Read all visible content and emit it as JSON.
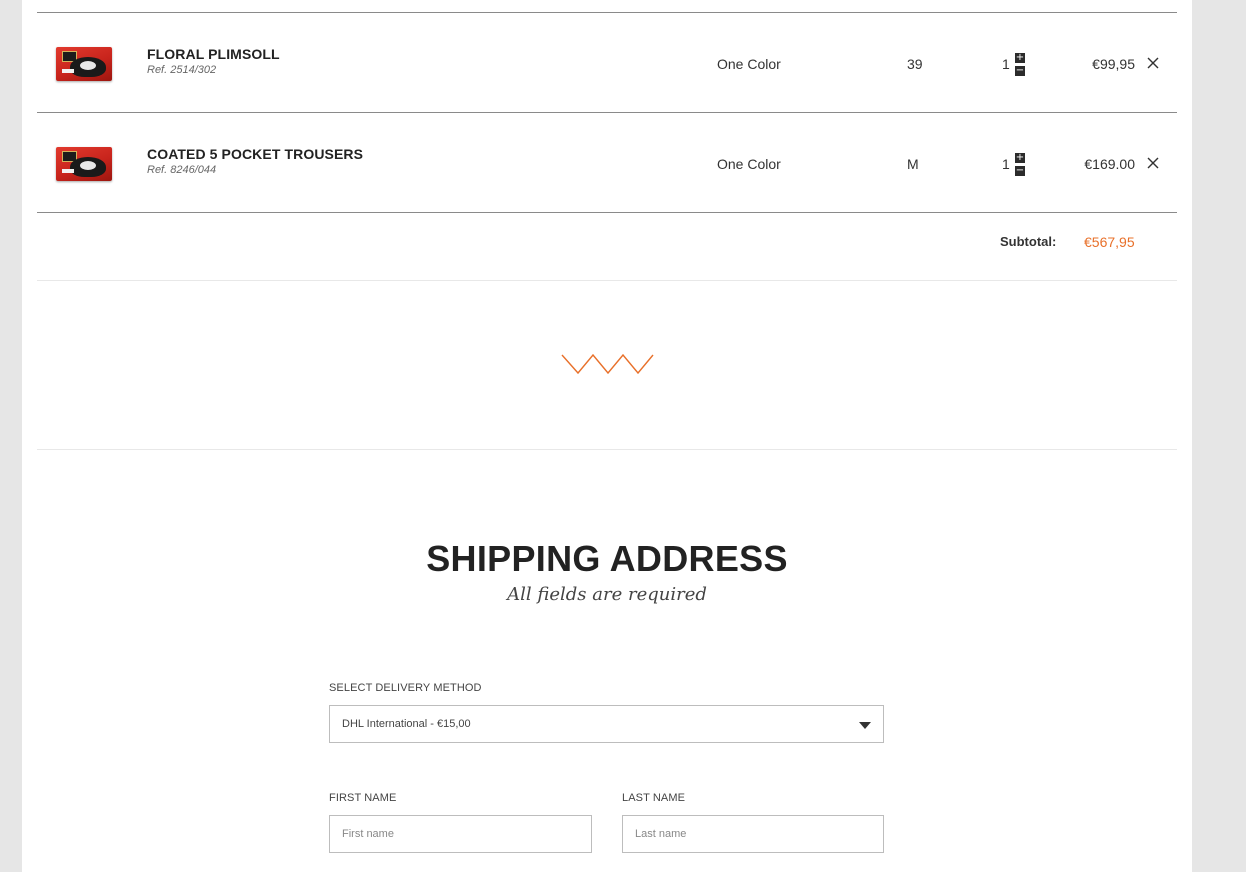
{
  "cart": {
    "items": [
      {
        "name": "FLORAL PLIMSOLL",
        "ref": "Ref. 2514/302",
        "color": "One Color",
        "size": "39",
        "qty": "1",
        "price": "€99,95",
        "image_icon": "product-thumbnail"
      },
      {
        "name": "COATED 5 POCKET TROUSERS",
        "ref": "Ref. 8246/044",
        "color": "One Color",
        "size": "M",
        "qty": "1",
        "price": "€169.00",
        "image_icon": "product-thumbnail"
      }
    ],
    "stepper": {
      "plus": "+",
      "minus": "−"
    },
    "remove_icon": "close-icon",
    "subtotal_label": "Subtotal:",
    "subtotal_value": "€567,95"
  },
  "divider_icon": "zigzag-divider-icon",
  "shipping": {
    "title": "SHIPPING ADDRESS",
    "subtitle": "All fields are required",
    "delivery_label": "SELECT DELIVERY METHOD",
    "delivery_value": "DHL International - €15,00",
    "first_name_label": "FIRST NAME",
    "first_name_placeholder": "First name",
    "last_name_label": "LAST NAME",
    "last_name_placeholder": "Last name"
  },
  "colors": {
    "accent": "#e8702a",
    "text": "#222222",
    "background": "#e6e6e6",
    "panel": "#ffffff"
  }
}
